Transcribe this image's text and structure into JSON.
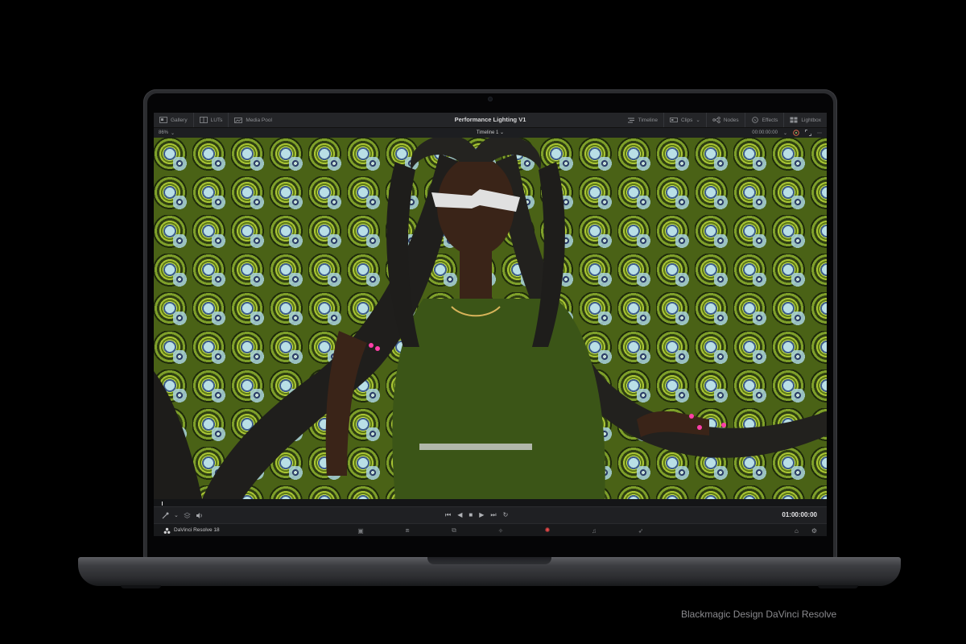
{
  "topbar": {
    "left_items": [
      {
        "label": "Gallery",
        "icon": "gallery-icon"
      },
      {
        "label": "LUTs",
        "icon": "luts-icon"
      },
      {
        "label": "Media Pool",
        "icon": "media-pool-icon"
      }
    ],
    "project_title": "Performance Lighting V1",
    "right_items": [
      {
        "label": "Timeline",
        "icon": "timeline-icon"
      },
      {
        "label": "Clips",
        "icon": "clips-icon"
      },
      {
        "label": "Nodes",
        "icon": "nodes-icon"
      },
      {
        "label": "Effects",
        "icon": "effects-icon"
      },
      {
        "label": "Lightbox",
        "icon": "lightbox-icon"
      }
    ]
  },
  "viewer_bar": {
    "zoom": "86%",
    "timeline_name": "Timeline 1",
    "timecode": "00:00:00:00"
  },
  "transport": {
    "timecode": "01:00:00:00"
  },
  "page_bar": {
    "app_name": "DaVinci Resolve 18",
    "pages": [
      "media-page",
      "cut-page",
      "edit-page",
      "fusion-page",
      "color-page",
      "fairlight-page",
      "deliver-page"
    ],
    "active_page": "color-page"
  },
  "colors": {
    "accent": "#e03c3c",
    "background": "#000000",
    "laptop_body": "#2b2c2f"
  },
  "caption": "Blackmagic Design DaVinci Resolve"
}
